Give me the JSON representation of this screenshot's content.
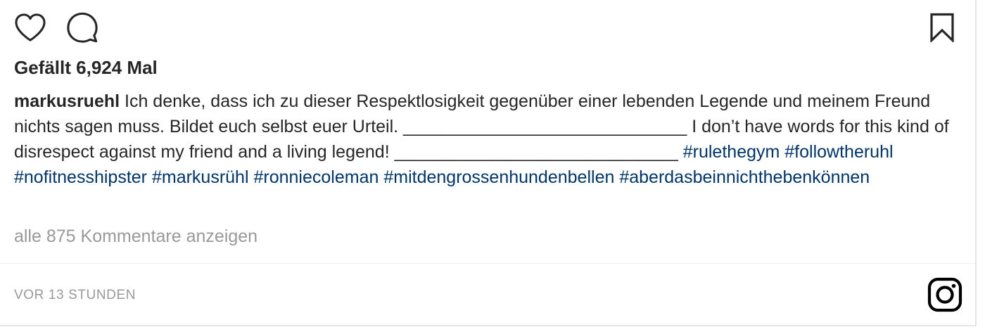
{
  "actions": {
    "like_icon": "heart-outline",
    "comment_icon": "speech-bubble-outline",
    "save_icon": "bookmark-outline"
  },
  "likes": {
    "text": "Gefällt 6,924 Mal"
  },
  "caption": {
    "username": "markusruehl",
    "text": " Ich denke, dass ich zu dieser Respektlosigkeit gegenüber einer lebenden Legende und meinem Freund nichts sagen muss. Bildet euch selbst euer Urteil. _____________________________ I don’t have words for this kind of disrespect against my friend and a living legend! _____________________________ ",
    "hashtags": [
      "#rulethegym",
      "#followtheruhl",
      "#nofitnesshipster",
      "#markusrühl",
      "#ronniecoleman",
      "#mitdengrossenhundenbellen",
      "#aberdasbeinnichthebenkönnen"
    ]
  },
  "comments": {
    "view_all_label": "alle 875 Kommentare anzeigen"
  },
  "footer": {
    "timestamp": "VOR 13 STUNDEN",
    "logo_icon": "instagram-glyph"
  },
  "colors": {
    "text": "#262626",
    "hashtag": "#003569",
    "muted": "#999999",
    "divider": "#efefef"
  }
}
